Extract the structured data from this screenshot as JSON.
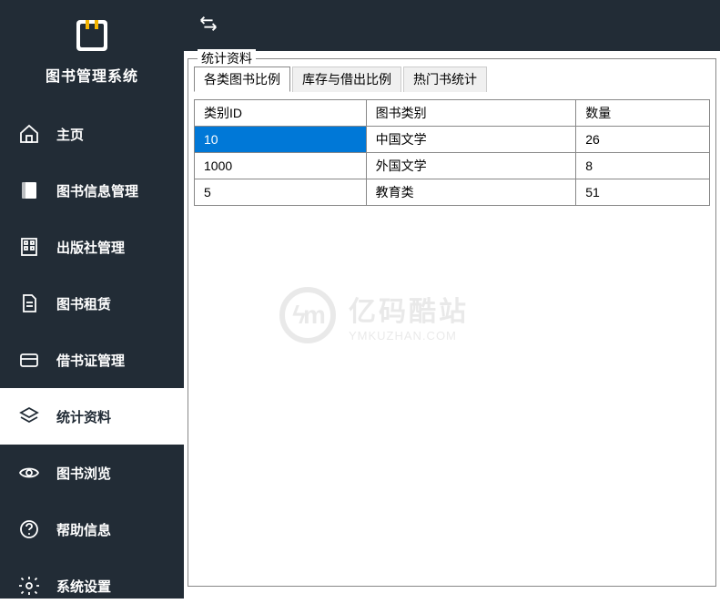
{
  "app": {
    "name": "图书管理系统"
  },
  "sidebar": {
    "items": [
      {
        "label": "主页",
        "icon": "home",
        "active": false
      },
      {
        "label": "图书信息管理",
        "icon": "book",
        "active": false
      },
      {
        "label": "出版社管理",
        "icon": "building",
        "active": false
      },
      {
        "label": "图书租赁",
        "icon": "document",
        "active": false
      },
      {
        "label": "借书证管理",
        "icon": "card",
        "active": false
      },
      {
        "label": "统计资料",
        "icon": "layers",
        "active": true
      },
      {
        "label": "图书浏览",
        "icon": "eye",
        "active": false
      },
      {
        "label": "帮助信息",
        "icon": "help",
        "active": false
      },
      {
        "label": "系统设置",
        "icon": "gear",
        "active": false
      }
    ]
  },
  "main": {
    "groupbox_title": "统计资料",
    "tabs": [
      {
        "label": "各类图书比例",
        "active": true
      },
      {
        "label": "库存与借出比例",
        "active": false
      },
      {
        "label": "热门书统计",
        "active": false
      }
    ],
    "table": {
      "columns": [
        "类别ID",
        "图书类别",
        "数量"
      ],
      "rows": [
        {
          "cells": [
            "10",
            "中国文学",
            "26"
          ],
          "selected": true
        },
        {
          "cells": [
            "1000",
            "外国文学",
            "8"
          ],
          "selected": false
        },
        {
          "cells": [
            "5",
            "教育类",
            "51"
          ],
          "selected": false
        }
      ]
    }
  },
  "watermark": {
    "logo_text": "ϟm",
    "main": "亿码酷站",
    "sub": "YMKUZHAN.COM"
  }
}
